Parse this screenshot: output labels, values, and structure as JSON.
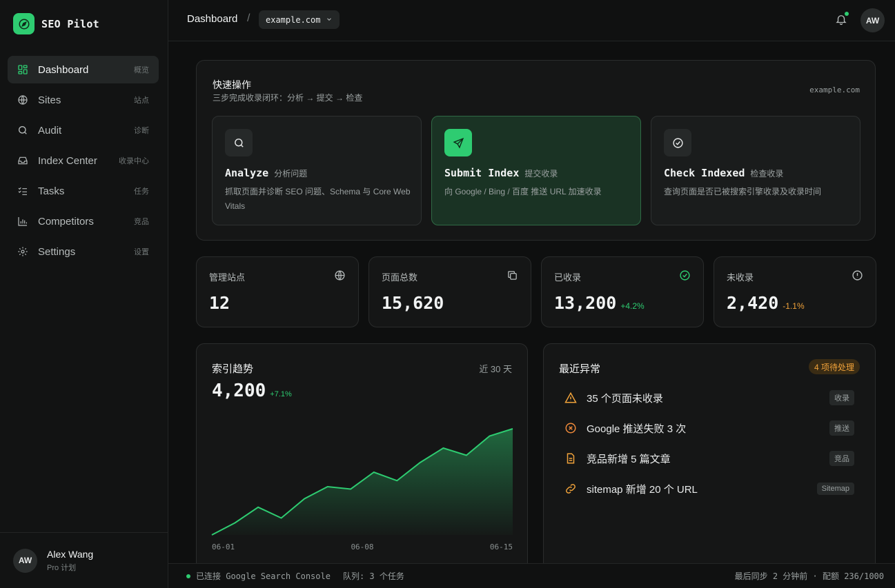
{
  "app": {
    "name": "SEO Pilot"
  },
  "sidebar": {
    "items": [
      {
        "label": "Dashboard",
        "zh": "概览",
        "icon": "dashboard-icon"
      },
      {
        "label": "Sites",
        "zh": "站点",
        "icon": "globe-icon"
      },
      {
        "label": "Audit",
        "zh": "诊断",
        "icon": "search-icon"
      },
      {
        "label": "Index Center",
        "zh": "收录中心",
        "icon": "inbox-icon"
      },
      {
        "label": "Tasks",
        "zh": "任务",
        "icon": "list-check-icon"
      },
      {
        "label": "Competitors",
        "zh": "竞品",
        "icon": "bar-chart-icon"
      },
      {
        "label": "Settings",
        "zh": "设置",
        "icon": "gear-icon"
      }
    ]
  },
  "user": {
    "initials": "AW",
    "name": "Alex Wang",
    "plan": "Pro 计划"
  },
  "header": {
    "breadcrumb": "Dashboard",
    "separator": "/",
    "site": "example.com",
    "avatar": "AW"
  },
  "quick_actions": {
    "title": "快速操作",
    "subtitle": "三步完成收录闭环：分析 → 提交 → 检查",
    "site": "example.com",
    "actions": [
      {
        "name": "Analyze",
        "zh": "分析问题",
        "desc": "抓取页面并诊断 SEO 问题、Schema 与 Core Web Vitals"
      },
      {
        "name": "Submit Index",
        "zh": "提交收录",
        "desc": "向 Google / Bing / 百度 推送 URL 加速收录"
      },
      {
        "name": "Check Indexed",
        "zh": "检查收录",
        "desc": "查询页面是否已被搜索引擎收录及收录时间"
      }
    ]
  },
  "stats": [
    {
      "label": "管理站点",
      "value": "12",
      "delta": ""
    },
    {
      "label": "页面总数",
      "value": "15,620",
      "delta": ""
    },
    {
      "label": "已收录",
      "value": "13,200",
      "delta": "+4.2%"
    },
    {
      "label": "未收录",
      "value": "2,420",
      "delta": "-1.1%"
    }
  ],
  "trend": {
    "title": "索引趋势",
    "range": "近 30 天",
    "value": "4,200",
    "delta": "+7.1%"
  },
  "chart_data": {
    "type": "area",
    "title": "索引趋势",
    "x_tick_labels": [
      "06-01",
      "06-08",
      "06-15"
    ],
    "values": [
      0.0,
      0.1,
      0.23,
      0.14,
      0.3,
      0.4,
      0.38,
      0.52,
      0.45,
      0.6,
      0.72,
      0.66,
      0.82,
      0.88
    ],
    "color": "#2ecc71"
  },
  "alerts": {
    "title": "最近异常",
    "badge": "4 项待处理",
    "items": [
      {
        "text": "35 个页面未收录",
        "tag": "收录",
        "icon": "warning-icon"
      },
      {
        "text": "Google 推送失败 3 次",
        "tag": "推送",
        "icon": "x-circle-icon"
      },
      {
        "text": "竞品新增 5 篇文章",
        "tag": "竞品",
        "icon": "document-icon"
      },
      {
        "text": "sitemap 新增 20 个 URL",
        "tag": "Sitemap",
        "icon": "link-icon"
      }
    ]
  },
  "footer": {
    "status": "已连接 Google Search Console",
    "queue": "队列: 3 个任务",
    "sync": "最后同步 2 分钟前 · 配额 236/1000"
  },
  "colors": {
    "accent": "#2ecc71",
    "warning": "#f0a23a",
    "danger": "#f08a3a"
  }
}
